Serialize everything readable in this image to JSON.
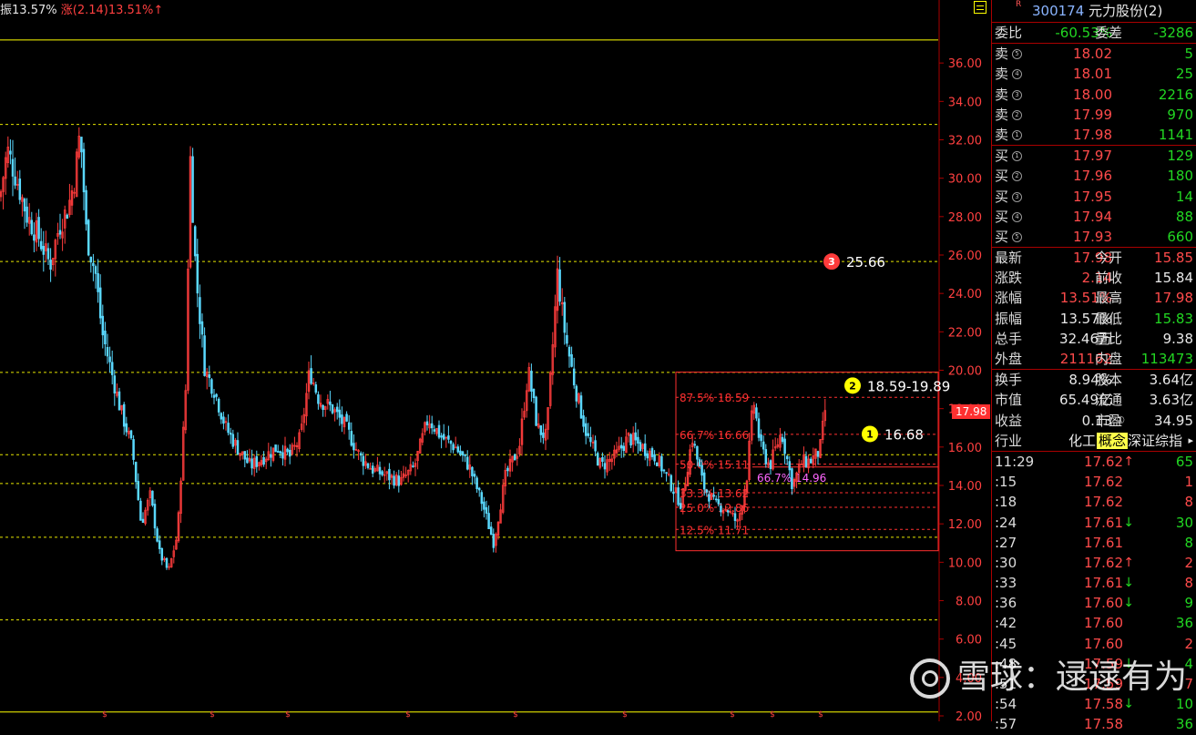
{
  "topbar": {
    "amp_label": "振",
    "amp_value": "13.57%",
    "chg_label": "涨",
    "chg_value": "(2.14)",
    "chg_pct": "13.51%",
    "arrow": "↑"
  },
  "panel": {
    "r_mark": "R",
    "code": "300174",
    "name": "元力股份(2)",
    "weibi_label": "委比",
    "weibi": "-60.53%",
    "weicha_label": "委差",
    "weicha": "-3286",
    "sell": [
      {
        "label": "卖",
        "n": "5",
        "price": "18.02",
        "vol": "5"
      },
      {
        "label": "卖",
        "n": "4",
        "price": "18.01",
        "vol": "25"
      },
      {
        "label": "卖",
        "n": "3",
        "price": "18.00",
        "vol": "2216"
      },
      {
        "label": "卖",
        "n": "2",
        "price": "17.99",
        "vol": "970"
      },
      {
        "label": "卖",
        "n": "1",
        "price": "17.98",
        "vol": "1141"
      }
    ],
    "buy": [
      {
        "label": "买",
        "n": "1",
        "price": "17.97",
        "vol": "129"
      },
      {
        "label": "买",
        "n": "2",
        "price": "17.96",
        "vol": "180"
      },
      {
        "label": "买",
        "n": "3",
        "price": "17.95",
        "vol": "14"
      },
      {
        "label": "买",
        "n": "4",
        "price": "17.94",
        "vol": "88"
      },
      {
        "label": "买",
        "n": "5",
        "price": "17.93",
        "vol": "660"
      }
    ],
    "quote": [
      {
        "l1": "最新",
        "v1": "17.98",
        "c1": "red",
        "l2": "今开",
        "v2": "15.85",
        "c2": "red"
      },
      {
        "l1": "涨跌",
        "v1": "2.14",
        "c1": "red",
        "l2": "前收",
        "v2": "15.84",
        "c2": "white"
      },
      {
        "l1": "涨幅",
        "v1": "13.51%",
        "c1": "red",
        "l2": "最高",
        "v2": "17.98",
        "c2": "red"
      },
      {
        "l1": "振幅",
        "v1": "13.57%",
        "c1": "white",
        "l2": "最低",
        "v2": "15.83",
        "c2": "green"
      },
      {
        "l1": "总手",
        "v1": "32.46万",
        "c1": "white",
        "l2": "量比",
        "v2": "9.38",
        "c2": "white"
      },
      {
        "l1": "外盘",
        "v1": "211162",
        "c1": "red",
        "l2": "内盘",
        "v2": "113473",
        "c2": "green"
      }
    ],
    "fund": [
      {
        "l1": "换手",
        "v1": "8.94%",
        "l2": "股本",
        "v2": "3.64亿"
      },
      {
        "l1": "市值",
        "v1": "65.49亿",
        "l2": "流通",
        "v2": "3.63亿"
      },
      {
        "l1": "收益",
        "v1": "0.13",
        "v1_mark": "①",
        "l2": "市盈",
        "v2": "34.95"
      }
    ],
    "industry_label": "行业",
    "industry": "化工",
    "concept_tag": "概念",
    "concept": "深证综指",
    "ticks": [
      {
        "t": "11:29",
        "p": "17.62",
        "a": "↑",
        "ac": "red",
        "v": "65",
        "vc": "green"
      },
      {
        "t": ":15",
        "p": "17.62",
        "a": "",
        "ac": "red",
        "v": "1",
        "vc": "red"
      },
      {
        "t": ":18",
        "p": "17.62",
        "a": "",
        "ac": "red",
        "v": "8",
        "vc": "red"
      },
      {
        "t": ":24",
        "p": "17.61",
        "a": "↓",
        "ac": "green",
        "v": "30",
        "vc": "green"
      },
      {
        "t": ":27",
        "p": "17.61",
        "a": "",
        "ac": "green",
        "v": "8",
        "vc": "green"
      },
      {
        "t": ":30",
        "p": "17.62",
        "a": "↑",
        "ac": "red",
        "v": "2",
        "vc": "red"
      },
      {
        "t": ":33",
        "p": "17.61",
        "a": "↓",
        "ac": "green",
        "v": "8",
        "vc": "red"
      },
      {
        "t": ":36",
        "p": "17.60",
        "a": "↓",
        "ac": "green",
        "v": "9",
        "vc": "green"
      },
      {
        "t": ":42",
        "p": "17.60",
        "a": "",
        "ac": "green",
        "v": "36",
        "vc": "green"
      },
      {
        "t": ":45",
        "p": "17.60",
        "a": "",
        "ac": "green",
        "v": "2",
        "vc": "red"
      },
      {
        "t": ":48",
        "p": "17.59",
        "a": "↓",
        "ac": "green",
        "v": "4",
        "vc": "green"
      },
      {
        "t": ":51",
        "p": "17.59",
        "a": "",
        "ac": "green",
        "v": "7",
        "vc": "red"
      },
      {
        "t": ":54",
        "p": "17.58",
        "a": "↓",
        "ac": "green",
        "v": "10",
        "vc": "green"
      },
      {
        "t": ":57",
        "p": "17.58",
        "a": "",
        "ac": "green",
        "v": "36",
        "vc": "green"
      }
    ]
  },
  "watermark": "雪球：逯逯有为",
  "chart_data": {
    "type": "candlestick",
    "ylim": [
      2,
      38
    ],
    "yticks": [
      "2.00",
      "4.00",
      "6.00",
      "8.00",
      "10.00",
      "12.00",
      "14.00",
      "16.00",
      "18.00",
      "20.00",
      "22.00",
      "24.00",
      "26.00",
      "28.00",
      "30.00",
      "32.00",
      "34.00",
      "36.00"
    ],
    "last_price": "17.98",
    "marker_glyph": "$",
    "h_lines": [
      {
        "y": 37.2,
        "color": "#ffff00",
        "style": "solid"
      },
      {
        "y": 32.8,
        "color": "#e6e600",
        "style": "dashed"
      },
      {
        "y": 25.66,
        "color": "#e6e600",
        "style": "dashed"
      },
      {
        "y": 19.89,
        "color": "#e6e600",
        "style": "dashed"
      },
      {
        "y": 15.6,
        "color": "#e6e600",
        "style": "dashed"
      },
      {
        "y": 14.1,
        "color": "#e6e600",
        "style": "dashed"
      },
      {
        "y": 11.3,
        "color": "#e6e600",
        "style": "dashed"
      },
      {
        "y": 7.0,
        "color": "#e6e600",
        "style": "dashed"
      },
      {
        "y": 2.2,
        "color": "#ffff00",
        "style": "solid"
      }
    ],
    "callouts": [
      {
        "n": "3",
        "text": "25.66",
        "y": 25.66,
        "color": "#ff3b3b"
      },
      {
        "n": "2",
        "text": "18.59-19.89",
        "y": 19.2,
        "color": "#ffff00"
      },
      {
        "n": "1",
        "text": "16.68",
        "y": 16.68,
        "color": "#ffff00"
      }
    ],
    "fib_levels": [
      {
        "pct": "87.5%",
        "value": "18.59",
        "y": 18.59
      },
      {
        "pct": "66.7%",
        "value": "16.66",
        "y": 16.66
      },
      {
        "pct": "50.0%",
        "value": "15.11",
        "y": 15.11
      },
      {
        "pct": "33.3%",
        "value": "13.62",
        "y": 13.62
      },
      {
        "pct": "25.0%",
        "value": "12.86",
        "y": 12.86
      },
      {
        "pct": "12.5%",
        "value": "11.71",
        "y": 11.71
      }
    ],
    "fib_range": [
      10.6,
      19.9
    ],
    "fib_small": {
      "pct": "66.7%",
      "value": "14.96",
      "y": 14.96
    },
    "anchors": [
      [
        0,
        29
      ],
      [
        8,
        31.5
      ],
      [
        18,
        30
      ],
      [
        30,
        28
      ],
      [
        42,
        27
      ],
      [
        55,
        25.5
      ],
      [
        65,
        27.5
      ],
      [
        75,
        28.5
      ],
      [
        82,
        30
      ],
      [
        88,
        32.5
      ],
      [
        95,
        27
      ],
      [
        105,
        25
      ],
      [
        112,
        22
      ],
      [
        122,
        20
      ],
      [
        132,
        18
      ],
      [
        145,
        16
      ],
      [
        155,
        12
      ],
      [
        165,
        13.5
      ],
      [
        175,
        10.5
      ],
      [
        185,
        9.5
      ],
      [
        195,
        11.5
      ],
      [
        205,
        20
      ],
      [
        208,
        32
      ],
      [
        215,
        25
      ],
      [
        225,
        20
      ],
      [
        235,
        19
      ],
      [
        248,
        17
      ],
      [
        260,
        16
      ],
      [
        275,
        15
      ],
      [
        290,
        15.5
      ],
      [
        305,
        16
      ],
      [
        318,
        15.5
      ],
      [
        330,
        16.5
      ],
      [
        340,
        20
      ],
      [
        350,
        18.5
      ],
      [
        365,
        18
      ],
      [
        380,
        17
      ],
      [
        395,
        15.5
      ],
      [
        410,
        14.8
      ],
      [
        425,
        14.5
      ],
      [
        440,
        14.2
      ],
      [
        455,
        15
      ],
      [
        470,
        17.5
      ],
      [
        485,
        16.5
      ],
      [
        500,
        16
      ],
      [
        515,
        15
      ],
      [
        530,
        13
      ],
      [
        542,
        11
      ],
      [
        555,
        14.5
      ],
      [
        570,
        16
      ],
      [
        580,
        20
      ],
      [
        590,
        17
      ],
      [
        600,
        16.5
      ],
      [
        612,
        25
      ],
      [
        620,
        22
      ],
      [
        632,
        19
      ],
      [
        645,
        16.5
      ],
      [
        660,
        15
      ],
      [
        675,
        15.5
      ],
      [
        690,
        16.5
      ],
      [
        705,
        16
      ],
      [
        720,
        15.5
      ],
      [
        735,
        14.2
      ],
      [
        748,
        13
      ],
      [
        760,
        16.5
      ],
      [
        772,
        14
      ],
      [
        785,
        13
      ],
      [
        798,
        12.8
      ],
      [
        810,
        12
      ],
      [
        820,
        14.5
      ],
      [
        827,
        18.5
      ],
      [
        835,
        16
      ],
      [
        845,
        15
      ],
      [
        858,
        16.8
      ],
      [
        870,
        14
      ],
      [
        880,
        15.2
      ],
      [
        890,
        15.3
      ],
      [
        900,
        15.8
      ],
      [
        906,
        17.98
      ]
    ]
  }
}
